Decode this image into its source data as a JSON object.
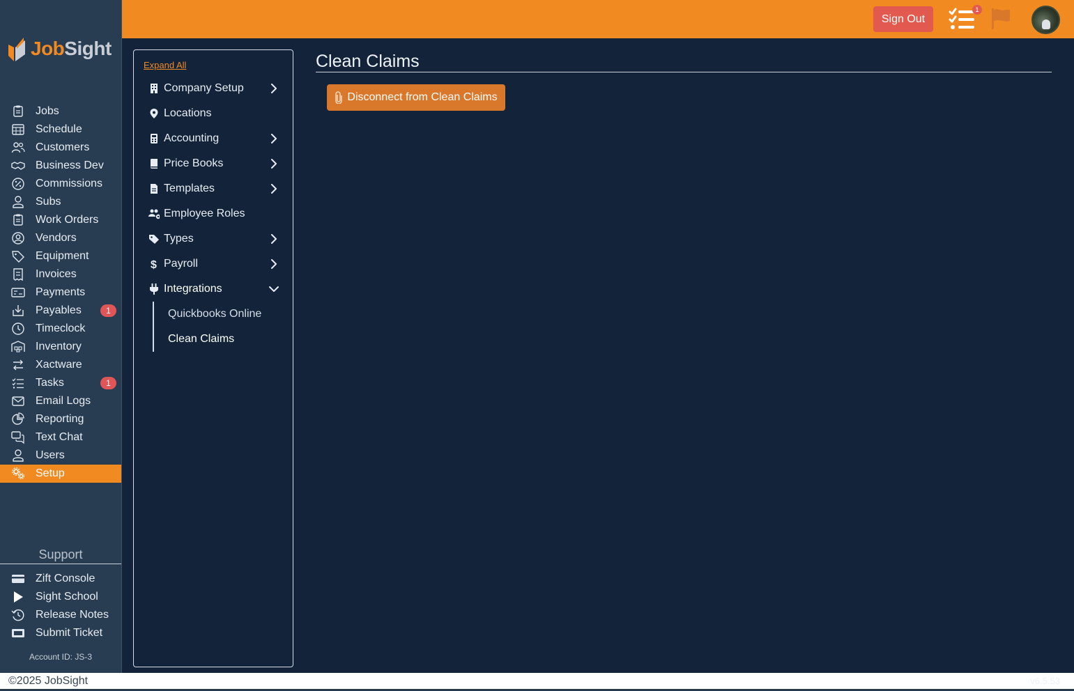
{
  "brand": {
    "part1": "Job",
    "part2": "Sight",
    "accent": "#f28a22",
    "sidebar_bg": "#283c52",
    "content_bg": "#12233a"
  },
  "header": {
    "sign_out_label": "Sign Out",
    "tasks_badge": "1"
  },
  "sidebar": {
    "items": [
      {
        "label": "Jobs",
        "icon": "clipboard-icon"
      },
      {
        "label": "Schedule",
        "icon": "calendar-icon"
      },
      {
        "label": "Customers",
        "icon": "users-icon"
      },
      {
        "label": "Business Dev",
        "icon": "handshake-icon"
      },
      {
        "label": "Commissions",
        "icon": "percent-icon"
      },
      {
        "label": "Subs",
        "icon": "user-icon"
      },
      {
        "label": "Work Orders",
        "icon": "clipboard-icon"
      },
      {
        "label": "Vendors",
        "icon": "user-circle-icon"
      },
      {
        "label": "Equipment",
        "icon": "tag-icon"
      },
      {
        "label": "Invoices",
        "icon": "receipt-icon"
      },
      {
        "label": "Payments",
        "icon": "money-icon"
      },
      {
        "label": "Payables",
        "icon": "download-icon",
        "badge": "1"
      },
      {
        "label": "Timeclock",
        "icon": "clock-icon"
      },
      {
        "label": "Inventory",
        "icon": "warehouse-icon"
      },
      {
        "label": "Xactware",
        "icon": "exchange-icon"
      },
      {
        "label": "Tasks",
        "icon": "list-check-icon",
        "badge": "1"
      },
      {
        "label": "Email Logs",
        "icon": "envelope-icon"
      },
      {
        "label": "Reporting",
        "icon": "pie-chart-icon"
      },
      {
        "label": "Text Chat",
        "icon": "chat-icon"
      },
      {
        "label": "Users",
        "icon": "user-icon"
      },
      {
        "label": "Setup",
        "icon": "cogs-icon",
        "active": true
      }
    ],
    "support_label": "Support",
    "support_items": [
      {
        "label": "Zift Console",
        "icon": "credit-card-icon"
      },
      {
        "label": "Sight School",
        "icon": "play-icon"
      },
      {
        "label": "Release Notes",
        "icon": "history-icon"
      },
      {
        "label": "Submit Ticket",
        "icon": "ticket-icon"
      }
    ],
    "account_id": "Account ID:  JS-3"
  },
  "settings": {
    "expand_all": "Expand All",
    "items": [
      {
        "label": "Company Setup",
        "icon": "building-icon",
        "chevron": "right"
      },
      {
        "label": "Locations",
        "icon": "map-pin-icon",
        "chevron": ""
      },
      {
        "label": "Accounting",
        "icon": "calculator-icon",
        "chevron": "right"
      },
      {
        "label": "Price Books",
        "icon": "book-icon",
        "chevron": "right"
      },
      {
        "label": "Templates",
        "icon": "file-icon",
        "chevron": "right"
      },
      {
        "label": "Employee Roles",
        "icon": "users-cog-icon",
        "chevron": ""
      },
      {
        "label": "Types",
        "icon": "tags-icon",
        "chevron": "right"
      },
      {
        "label": "Payroll",
        "icon": "dollar-icon",
        "chevron": "right"
      },
      {
        "label": "Integrations",
        "icon": "plug-icon",
        "chevron": "down",
        "open": true
      }
    ],
    "integrations_children": [
      {
        "label": "Quickbooks Online"
      },
      {
        "label": "Clean Claims",
        "current": true
      }
    ]
  },
  "main": {
    "title": "Clean Claims",
    "disconnect_label": "Disconnect from Clean Claims"
  },
  "footer": {
    "copyright": "©2025 JobSight",
    "version": "v6.5.53"
  }
}
